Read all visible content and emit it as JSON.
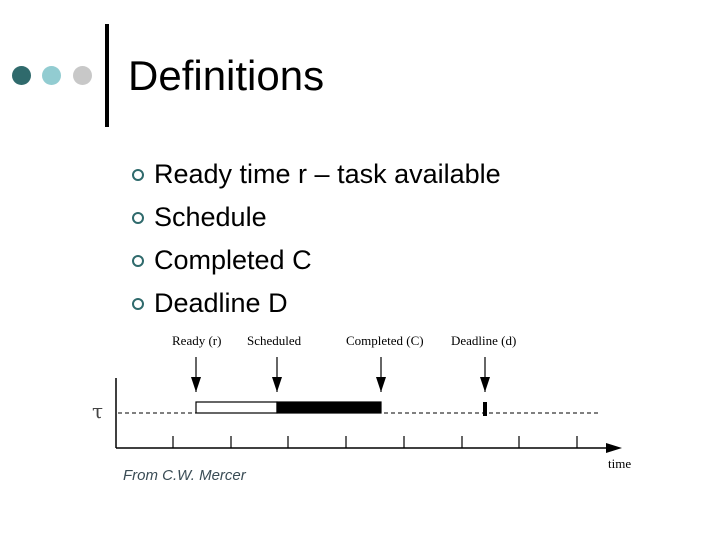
{
  "slide": {
    "title": "Definitions",
    "decor_dot_colors": [
      "#2f6a6c",
      "#92ccd1",
      "#c8c8c8"
    ],
    "bullets": [
      {
        "text": "Ready time r – task available"
      },
      {
        "text": "Schedule"
      },
      {
        "text": "Completed C"
      },
      {
        "text": "Deadline D"
      }
    ],
    "credit": "From C.W. Mercer"
  },
  "timeline": {
    "y_label": "τ",
    "x_label": "time",
    "events": [
      {
        "label": "Ready (r)",
        "key": "ready"
      },
      {
        "label": "Scheduled",
        "key": "scheduled"
      },
      {
        "label": "Completed (C)",
        "key": "completed"
      },
      {
        "label": "Deadline (d)",
        "key": "deadline"
      }
    ],
    "segments": [
      {
        "name": "waiting",
        "from": "ready",
        "to": "scheduled",
        "fill": "#ffffff"
      },
      {
        "name": "executing",
        "from": "scheduled",
        "to": "completed",
        "fill": "#000000"
      }
    ],
    "tick_count": 8
  }
}
